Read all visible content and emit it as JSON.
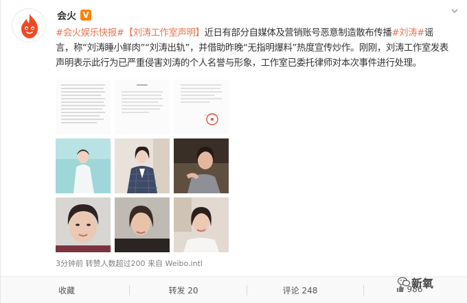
{
  "post": {
    "username": "会火",
    "vip_badge": "V",
    "text": {
      "tag1": "#会火娱乐快报#",
      "bracket_title": "【刘涛工作室声明】",
      "l1_rest": "近日有部分自媒体及营销账号恶意制造散布传播",
      "tag2": "#刘涛#",
      "l1_end": "谣",
      "line2": "言，称“刘涛睡小鲜肉”“刘涛出轨”，并借助昨晚“无指明爆料”热度宣传炒作。刚刚，刘涛工作室发表",
      "line3": "声明表示此行为已严重侵害刘涛的个人名誉与形象，工作室已委托律师对本次事件进行处理。"
    },
    "images": [
      {
        "type": "document",
        "name": "statement-page-1"
      },
      {
        "type": "document",
        "name": "statement-page-2"
      },
      {
        "type": "document",
        "name": "statement-page-3"
      },
      {
        "type": "photo",
        "name": "photo-white-dress"
      },
      {
        "type": "photo",
        "name": "photo-plaid-suit"
      },
      {
        "type": "photo",
        "name": "photo-selfie-gray-top"
      },
      {
        "type": "photo",
        "name": "photo-selfie-closeup"
      },
      {
        "type": "photo",
        "name": "photo-selfie-car"
      },
      {
        "type": "photo",
        "name": "photo-white-top"
      }
    ],
    "meta": "3分钟前 转赞人数超过200 来自 Weibo.intl"
  },
  "actions": {
    "favorite": "收藏",
    "repost": "转发 20",
    "comment": "评论 248",
    "like": "986"
  },
  "watermark": "新氧",
  "colors": {
    "link": "#eb7350",
    "badge": "#ff8200",
    "avatar_flame": "#f04a23"
  },
  "icons": [
    "flame-avatar-icon",
    "chevron-down-icon",
    "like-icon",
    "wechat-icon"
  ]
}
